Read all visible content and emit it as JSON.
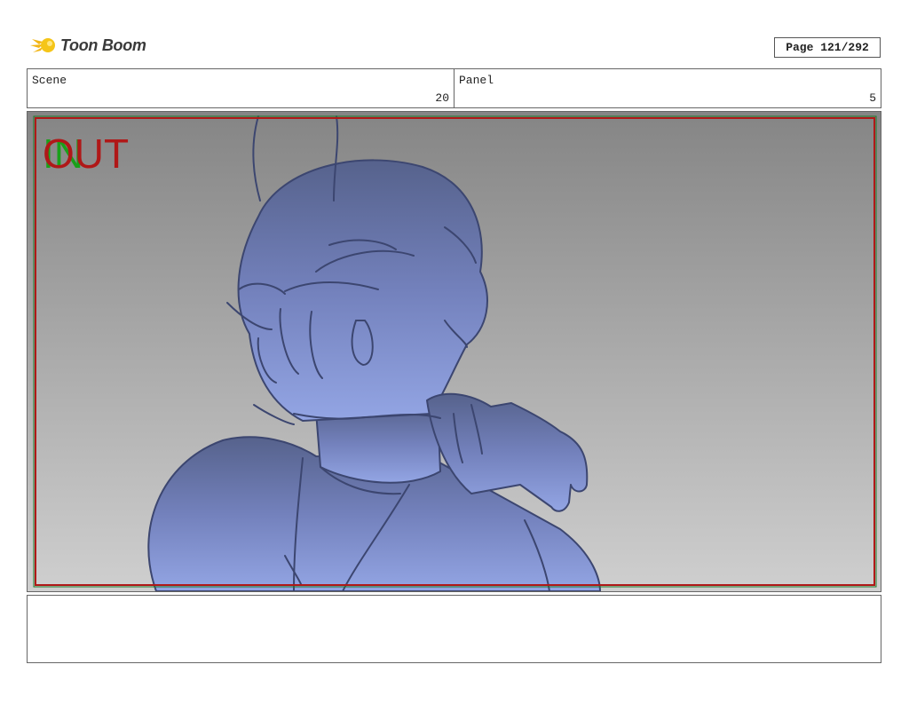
{
  "header": {
    "logo_text": "Toon Boom",
    "page_label": "Page 121/292"
  },
  "scene": {
    "label": "Scene",
    "value": "20"
  },
  "panel": {
    "label": "Panel",
    "value": "5"
  },
  "overlay": {
    "in_text": "IN",
    "out_text": "OUT"
  },
  "colors": {
    "safe_frame": "#b01818",
    "in_color": "#1aa01a",
    "figure_fill": "#6f80c0",
    "line": "#3c4670"
  },
  "icons": {
    "logo": "toon-boom-logo-icon"
  }
}
